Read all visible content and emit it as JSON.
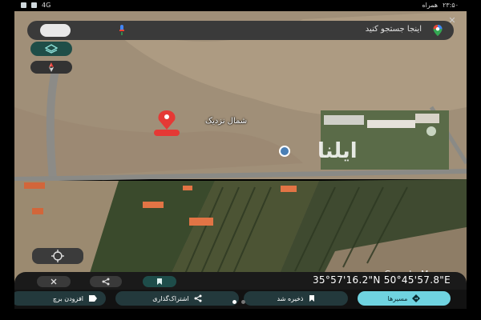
{
  "status_bar": {
    "time": "۲۳:۵۰",
    "carrier": "همراه",
    "network": "4G"
  },
  "search": {
    "placeholder": "اینجا جستجو کنید",
    "logo_icon": "google-maps-pin-icon",
    "mic_icon": "mic-icon"
  },
  "map": {
    "pin_label": "شمال نزدیک",
    "attribution": "Google Maps",
    "watermark": "ایلنا",
    "colors": {
      "field": "#a08f78",
      "road": "#8a8a86",
      "pin": "#e53935",
      "trees": "#3d4a2e"
    }
  },
  "place_sheet": {
    "coordinates": "35°57'16.2\"N 50°45'57.8\"E",
    "close_icon": "close-icon",
    "share_icon": "share-icon",
    "save_icon": "bookmark-icon"
  },
  "actions": {
    "directions": "مسیرها",
    "saved": "ذخیره شد",
    "share": "اشتراک‌گذاری",
    "add": "افزودن برچ"
  }
}
